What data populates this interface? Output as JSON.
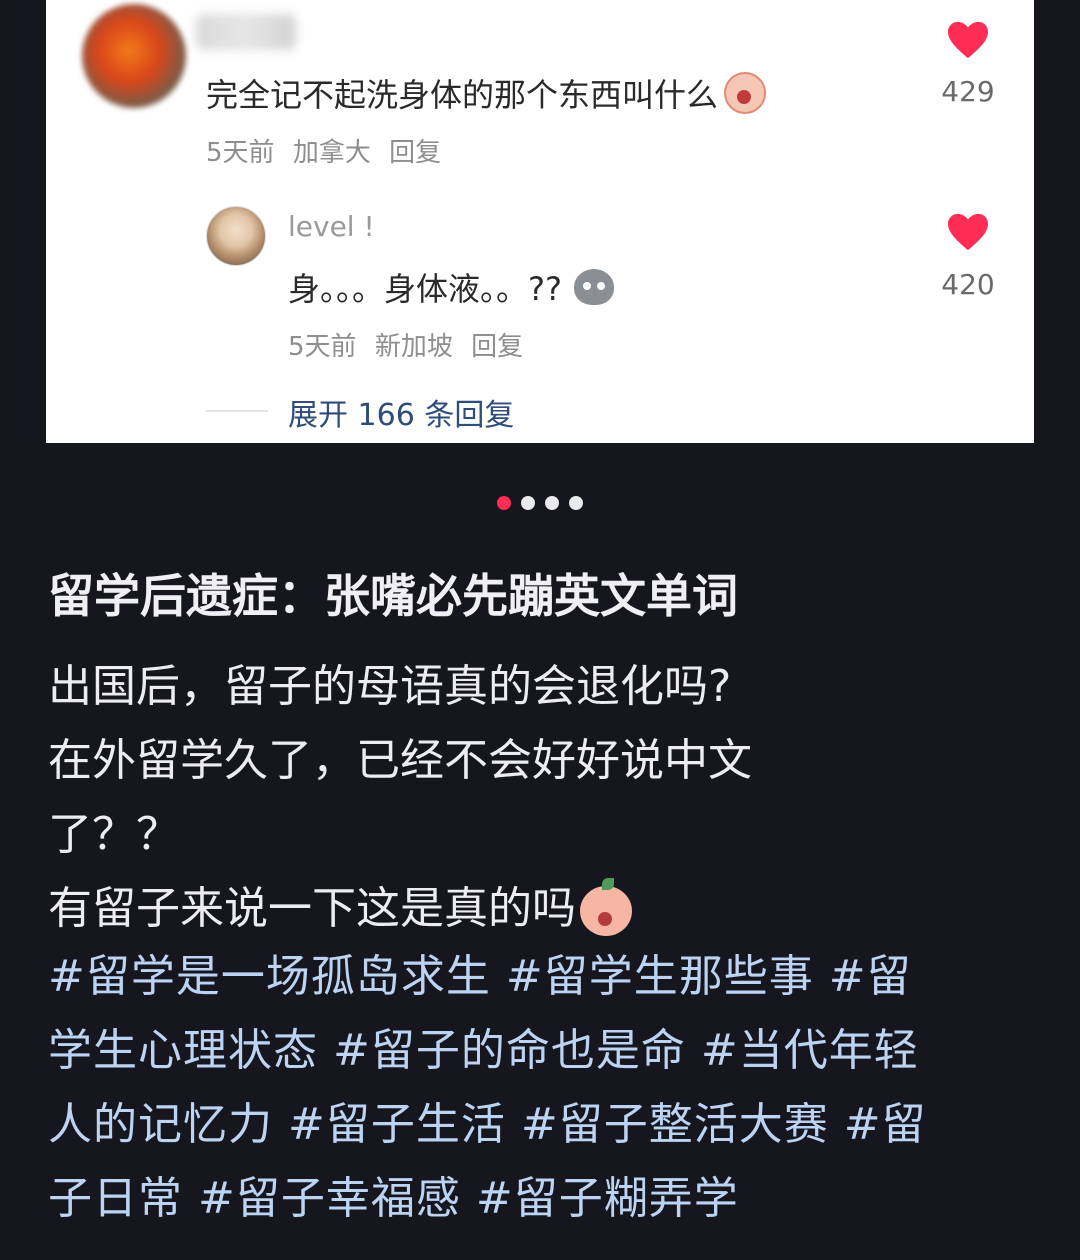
{
  "comment": {
    "text": "完全记不起洗身体的那个东西叫什么",
    "emoji": "scream-face-emoji",
    "time": "5天前",
    "location": "加拿大",
    "reply_label": "回复",
    "likes": "429"
  },
  "sub_comment": {
    "username": "level !",
    "text": "身。。。身体液。。??",
    "emoji": "gray-ghost-emoji",
    "time": "5天前",
    "location": "新加坡",
    "reply_label": "回复",
    "likes": "420"
  },
  "expand": {
    "label": "展开 166 条回复"
  },
  "carousel": {
    "count": 4,
    "active_index": 0,
    "active_color": "#ff2c55"
  },
  "post": {
    "title": "留学后遗症：张嘴必先蹦英文单词",
    "lines": [
      "出国后，留子的母语真的会退化吗?",
      "在外留学久了，已经不会好好说中文",
      "了？？",
      "有留子来说一下这是真的吗"
    ],
    "hashtags_lines": [
      "#留学是一场孤岛求生 #留学生那些事 #留",
      "学生心理状态 #留子的命也是命 #当代年轻",
      "人的记忆力 #留子生活 #留子整活大赛 #留",
      "子日常 #留子幸福感 #留子糊弄学"
    ]
  },
  "colors": {
    "heart": "#ff2c55",
    "link": "#2f4d7a",
    "hashtag": "#bcd3f2",
    "background": "#16161e"
  }
}
